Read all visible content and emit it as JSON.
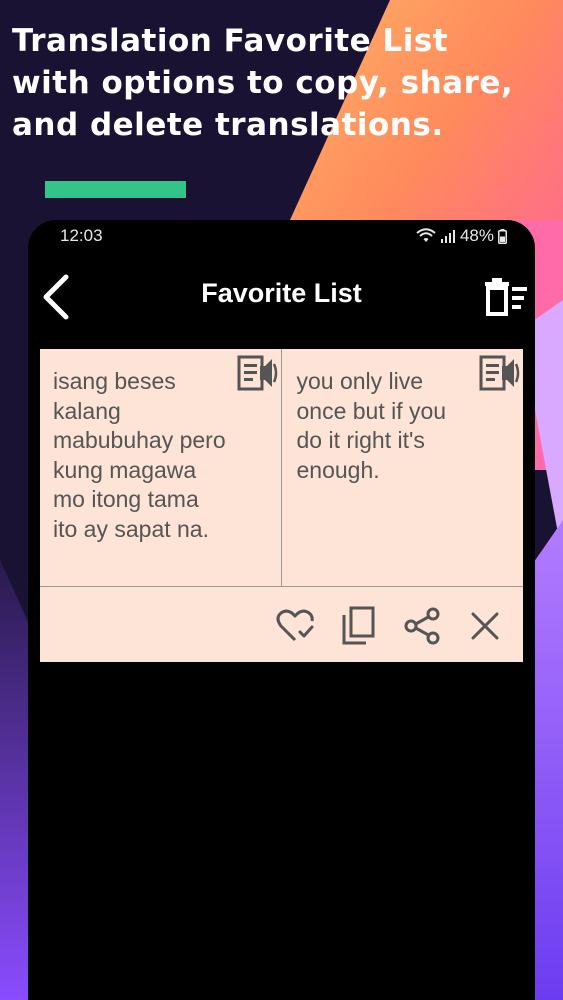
{
  "headline": {
    "line1": "Translation Favorite List",
    "line2": "with options to copy, share,",
    "line3": "and delete translations."
  },
  "status_bar": {
    "time": "12:03",
    "battery": "48%"
  },
  "app_bar": {
    "title": "Favorite List",
    "back_icon": "chevron-left-icon",
    "clear_icon": "delete-all-icon"
  },
  "favorite_item": {
    "source_text": "isang beses kalang mabubuhay pero kung magawa mo itong tama ito ay sapat na.",
    "translated_text": "you only live once but if you do it right it's enough.",
    "speak_icon": "speaker-document-icon",
    "actions": [
      "favorite-check-icon",
      "copy-icon",
      "share-icon",
      "close-icon"
    ]
  },
  "colors": {
    "card_background": "#fde4d6",
    "card_text": "#555555",
    "icon": "#555555",
    "accent_green": "#33c48a",
    "app_background": "#000000"
  }
}
